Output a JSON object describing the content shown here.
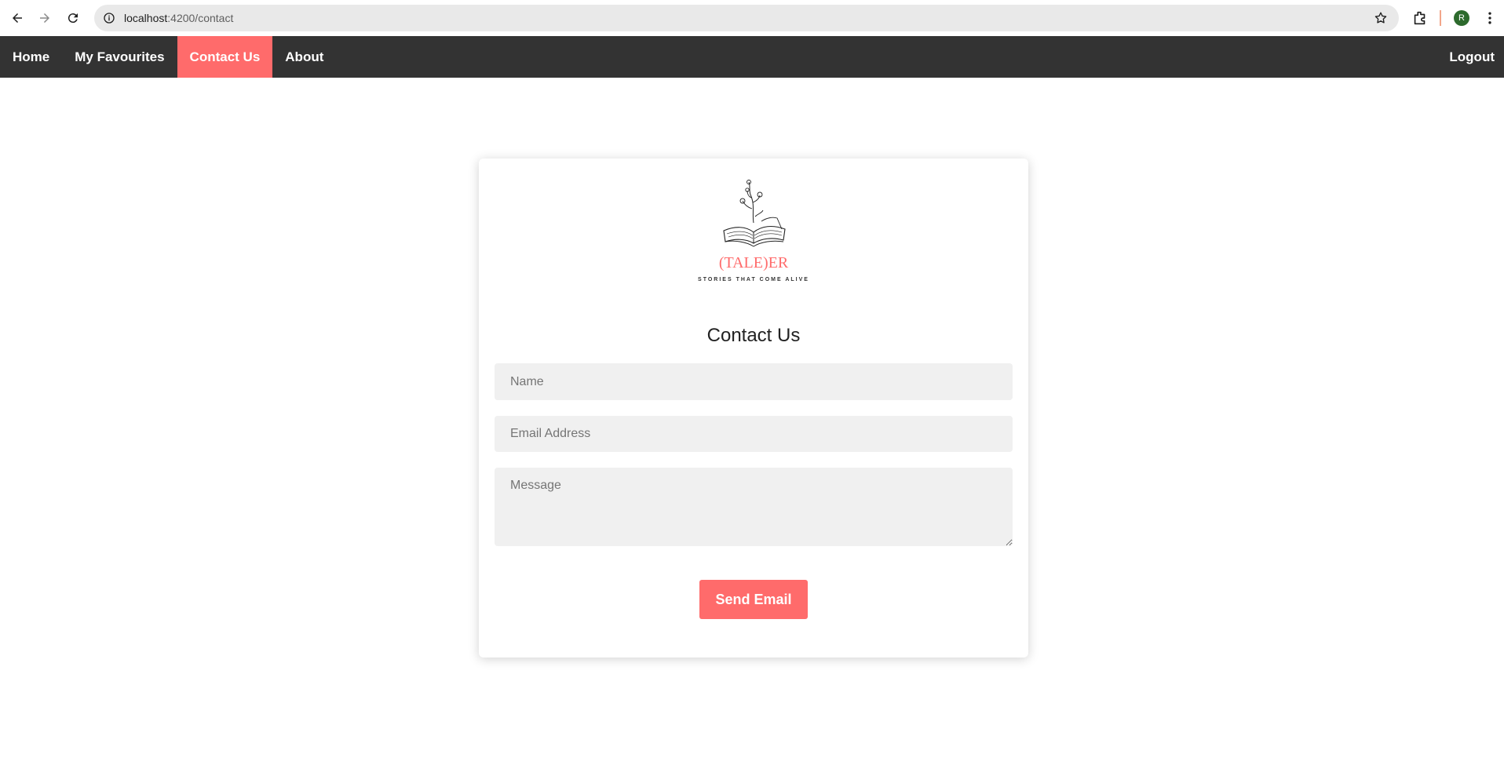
{
  "browser": {
    "url_host": "localhost",
    "url_path": ":4200/contact",
    "profile_initial": "R"
  },
  "navbar": {
    "items": [
      {
        "label": "Home",
        "active": false
      },
      {
        "label": "My Favourites",
        "active": false
      },
      {
        "label": "Contact Us",
        "active": true
      },
      {
        "label": "About",
        "active": false
      }
    ],
    "logout_label": "Logout",
    "background": "#333333",
    "active_color": "#ff6b6b"
  },
  "logo": {
    "name": "(TALE)ER",
    "tagline": "STORIES THAT COME ALIVE"
  },
  "form": {
    "title": "Contact Us",
    "name_placeholder": "Name",
    "email_placeholder": "Email Address",
    "message_placeholder": "Message",
    "submit_label": "Send Email",
    "accent": "#ff6b6b"
  }
}
